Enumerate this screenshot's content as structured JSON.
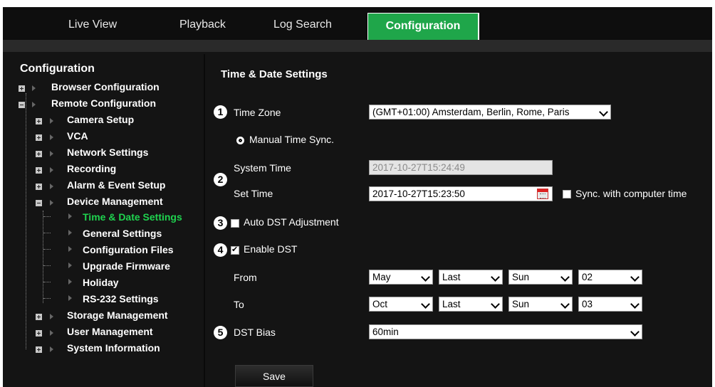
{
  "nav": {
    "tabs": [
      {
        "label": "Live View",
        "active": false
      },
      {
        "label": "Playback",
        "active": false
      },
      {
        "label": "Log Search",
        "active": false
      },
      {
        "label": "Configuration",
        "active": true
      }
    ],
    "active_color": "#1fa64a"
  },
  "sidebar": {
    "title": "Configuration",
    "items": [
      {
        "label": "Browser Configuration",
        "expander": "plus"
      },
      {
        "label": "Remote Configuration",
        "expander": "minus"
      },
      {
        "label": "Camera Setup",
        "expander": "plus"
      },
      {
        "label": "VCA",
        "expander": "plus"
      },
      {
        "label": "Network Settings",
        "expander": "plus"
      },
      {
        "label": "Recording",
        "expander": "plus"
      },
      {
        "label": "Alarm & Event Setup",
        "expander": "plus"
      },
      {
        "label": "Device Management",
        "expander": "minus"
      },
      {
        "label": "Time & Date Settings",
        "active": true
      },
      {
        "label": "General Settings"
      },
      {
        "label": "Configuration Files"
      },
      {
        "label": "Upgrade Firmware"
      },
      {
        "label": "Holiday"
      },
      {
        "label": "RS-232 Settings"
      },
      {
        "label": "Storage Management",
        "expander": "plus"
      },
      {
        "label": "User Management",
        "expander": "plus"
      },
      {
        "label": "System Information",
        "expander": "plus"
      }
    ],
    "active_color": "#1fd34f"
  },
  "main": {
    "heading": "Time & Date Settings",
    "callouts": [
      "1",
      "2",
      "3",
      "4",
      "5"
    ],
    "time_zone": {
      "label": "Time Zone",
      "value": "(GMT+01:00) Amsterdam, Berlin, Rome, Paris"
    },
    "manual_sync": {
      "label": "Manual Time Sync.",
      "selected": true
    },
    "system_time": {
      "label": "System Time",
      "value": "2017-10-27T15:24:49"
    },
    "set_time": {
      "label": "Set Time",
      "value": "2017-10-27T15:23:50"
    },
    "sync_computer": {
      "label": "Sync. with computer time",
      "checked": false
    },
    "auto_dst": {
      "label": "Auto DST Adjustment",
      "checked": false
    },
    "enable_dst": {
      "label": "Enable DST",
      "checked": true
    },
    "from": {
      "label": "From",
      "month": "May",
      "week": "Last",
      "day": "Sun",
      "hour": "02"
    },
    "to": {
      "label": "To",
      "month": "Oct",
      "week": "Last",
      "day": "Sun",
      "hour": "03"
    },
    "dst_bias": {
      "label": "DST Bias",
      "value": "60min"
    },
    "save_label": "Save"
  },
  "icons": [
    "calendar-icon",
    "chevron-down-icon",
    "tree-expand-icon",
    "tree-collapse-icon"
  ]
}
